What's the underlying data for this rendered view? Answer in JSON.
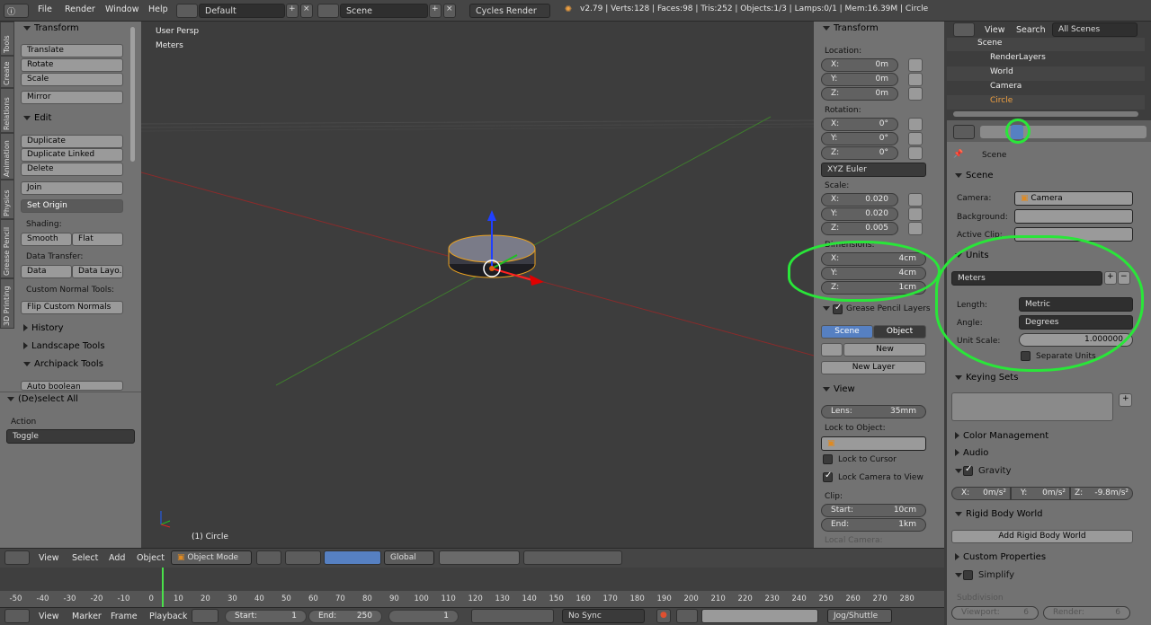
{
  "topbar": {
    "menus": [
      "File",
      "Render",
      "Window",
      "Help"
    ],
    "layout": "Default",
    "scene": "Scene",
    "engine": "Cycles Render",
    "stats": "v2.79 | Verts:128 | Faces:98 | Tris:252 | Objects:1/3 | Lamps:0/1 | Mem:16.39M | Circle"
  },
  "toolshelf": {
    "tabs": [
      "Tools",
      "Create",
      "Relations",
      "Animation",
      "Physics",
      "Grease Pencil",
      "3D Printing"
    ],
    "transform": {
      "title": "Transform",
      "buttons": [
        "Translate",
        "Rotate",
        "Scale",
        "Mirror"
      ]
    },
    "edit": {
      "title": "Edit",
      "buttons": [
        "Duplicate",
        "Duplicate Linked",
        "Delete",
        "Join"
      ],
      "set_origin": "Set Origin",
      "shading_label": "Shading:",
      "smooth": "Smooth",
      "flat": "Flat",
      "data_transfer_label": "Data Transfer:",
      "data": "Data",
      "data_layout": "Data Layo...",
      "custom_normal_label": "Custom Normal Tools:",
      "flip_normals": "Flip Custom Normals"
    },
    "history": "History",
    "landscape": "Landscape Tools",
    "archipack": "Archipack Tools",
    "auto_boolean": "Auto boolean"
  },
  "operator": {
    "title": "(De)select All",
    "action_label": "Action",
    "action_value": "Toggle"
  },
  "viewport": {
    "persp": "User Persp",
    "units": "Meters",
    "object_label": "(1) Circle"
  },
  "npanel": {
    "transform": "Transform",
    "location_label": "Location:",
    "location": [
      {
        "k": "X:",
        "v": "0m"
      },
      {
        "k": "Y:",
        "v": "0m"
      },
      {
        "k": "Z:",
        "v": "0m"
      }
    ],
    "rotation_label": "Rotation:",
    "rotation": [
      {
        "k": "X:",
        "v": "0°"
      },
      {
        "k": "Y:",
        "v": "0°"
      },
      {
        "k": "Z:",
        "v": "0°"
      }
    ],
    "rotation_mode": "XYZ Euler",
    "scale_label": "Scale:",
    "scale": [
      {
        "k": "X:",
        "v": "0.020"
      },
      {
        "k": "Y:",
        "v": "0.020"
      },
      {
        "k": "Z:",
        "v": "0.005"
      }
    ],
    "dimensions_label": "Dimensions:",
    "dimensions": [
      {
        "k": "X:",
        "v": "4cm"
      },
      {
        "k": "Y:",
        "v": "4cm"
      },
      {
        "k": "Z:",
        "v": "1cm"
      }
    ],
    "grease_pencil": "Grease Pencil Layers",
    "gp_scene": "Scene",
    "gp_object": "Object",
    "gp_new": "New",
    "gp_new_layer": "New Layer",
    "view": "View",
    "lens_label": "Lens:",
    "lens": "35mm",
    "lock_object": "Lock to Object:",
    "lock_cursor": "Lock to Cursor",
    "lock_camera": "Lock Camera to View",
    "clip_label": "Clip:",
    "clip_start_k": "Start:",
    "clip_start": "10cm",
    "clip_end_k": "End:",
    "clip_end": "1km",
    "local_camera": "Local Camera:"
  },
  "outliner": {
    "menu_view": "View",
    "menu_search": "Search",
    "filter": "All Scenes",
    "items": [
      "Scene",
      "RenderLayers",
      "World",
      "Camera",
      "Circle"
    ]
  },
  "properties": {
    "breadcrumb": "Scene",
    "scene_panel": "Scene",
    "camera_label": "Camera:",
    "camera_value": "Camera",
    "background_label": "Background:",
    "active_clip_label": "Active Clip:",
    "units_panel": "Units",
    "units_preset": "Meters",
    "length_label": "Length:",
    "length_value": "Metric",
    "angle_label": "Angle:",
    "angle_value": "Degrees",
    "unit_scale_label": "Unit Scale:",
    "unit_scale_value": "1.000000",
    "separate_units": "Separate Units",
    "keying_sets": "Keying Sets",
    "color_management": "Color Management",
    "audio": "Audio",
    "gravity": "Gravity",
    "gravity_x": "X:",
    "gravity_x_v": "0m/s²",
    "gravity_y": "Y:",
    "gravity_y_v": "0m/s²",
    "gravity_z": "Z:",
    "gravity_z_v": "-9.8m/s²",
    "rigid_body": "Rigid Body World",
    "add_rigid": "Add Rigid Body World",
    "custom_props": "Custom Properties",
    "simplify": "Simplify",
    "subdivision": "Subdivision",
    "viewport_label": "Viewport:",
    "viewport_value": "6",
    "render_label": "Render:",
    "render_value": "6"
  },
  "view3d_header": {
    "menus": [
      "View",
      "Select",
      "Add",
      "Object"
    ],
    "mode": "Object Mode",
    "orientation": "Global"
  },
  "timeline": {
    "ticks": [
      "-50",
      "-40",
      "-30",
      "-20",
      "-10",
      "0",
      "10",
      "20",
      "30",
      "40",
      "50",
      "60",
      "70",
      "80",
      "90",
      "100",
      "110",
      "120",
      "130",
      "140",
      "150",
      "160",
      "170",
      "180",
      "190",
      "200",
      "210",
      "220",
      "230",
      "240",
      "250",
      "260",
      "270",
      "280"
    ],
    "menus": [
      "View",
      "Marker",
      "Frame",
      "Playback"
    ],
    "start_label": "Start:",
    "start": "1",
    "end_label": "End:",
    "end": "250",
    "current": "1",
    "sync": "No Sync",
    "jog": "Jog/Shuttle"
  }
}
